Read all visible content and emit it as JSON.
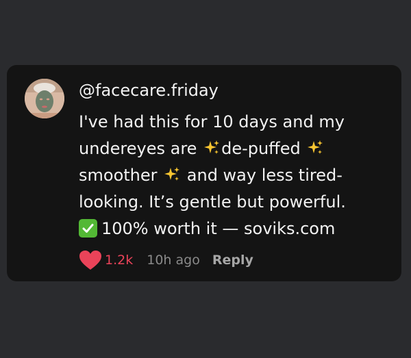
{
  "comment": {
    "username": "@facecare.friday",
    "lines": [
      {
        "text": "I've had this for 10 days and my"
      },
      {
        "before": "undereyes are ",
        "after": "de-puffed "
      },
      {
        "before": "smoother ",
        "after": " and way less tired-"
      },
      {
        "text": "looking. It’s gentle but powerful."
      },
      {
        "after_check": "100% worth it — soviks.com"
      }
    ],
    "like_count": "1.2k",
    "timestamp": "10h ago",
    "reply_label": "Reply"
  },
  "icons": {
    "sparkle": "sparkles-icon",
    "check": "check-mark-button-icon",
    "heart": "heart-icon"
  },
  "colors": {
    "background": "#2a2b2e",
    "card": "#141414",
    "text": "#f2f2f2",
    "like_red": "#ea4359",
    "sparkle_yellow": "#f7c531",
    "check_green": "#53b835",
    "muted": "#8a8a8a"
  }
}
